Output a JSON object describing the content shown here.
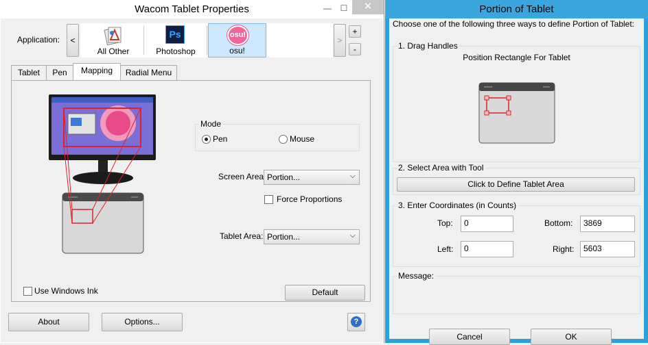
{
  "window1": {
    "title": "Wacom Tablet Properties",
    "minimize_glyph": "—",
    "maximize_glyph": "☐",
    "close_glyph": "✕",
    "application_label": "Application:",
    "scroll_left": "<",
    "scroll_right": ">",
    "add_glyph": "+",
    "remove_glyph": "-",
    "apps": [
      {
        "name": "All Other",
        "icon": "all-other-icon"
      },
      {
        "name": "Photoshop",
        "icon": "photoshop-icon",
        "icon_text": "Ps"
      },
      {
        "name": "osu!",
        "icon": "osu-icon",
        "icon_text": "osu!"
      }
    ],
    "selected_app": "osu!",
    "tabs": [
      "Tablet",
      "Pen",
      "Mapping",
      "Radial Menu"
    ],
    "active_tab": "Mapping",
    "mode": {
      "label": "Mode",
      "options": [
        "Pen",
        "Mouse"
      ],
      "selected": "Pen"
    },
    "screen_area": {
      "label": "Screen Area:",
      "value": "Portion..."
    },
    "force_proportions": {
      "label": "Force Proportions",
      "checked": false
    },
    "tablet_area": {
      "label": "Tablet Area:",
      "value": "Portion..."
    },
    "use_windows_ink": {
      "label": "Use Windows Ink",
      "checked": false
    },
    "default_button": "Default",
    "about_button": "About",
    "options_button": "Options...",
    "help_glyph": "?"
  },
  "window2": {
    "title": "Portion of Tablet",
    "instruction": "Choose one of the following three ways to define Portion of Tablet:",
    "group1": {
      "label": "1. Drag Handles",
      "caption": "Position Rectangle For Tablet"
    },
    "group2": {
      "label": "2. Select Area with Tool",
      "button": "Click to Define Tablet Area"
    },
    "group3": {
      "label": "3. Enter Coordinates (in Counts)",
      "top": {
        "label": "Top:",
        "value": "0"
      },
      "bottom": {
        "label": "Bottom:",
        "value": "3869"
      },
      "left": {
        "label": "Left:",
        "value": "0"
      },
      "right": {
        "label": "Right:",
        "value": "5603"
      }
    },
    "message_label": "Message:",
    "cancel_button": "Cancel",
    "ok_button": "OK"
  },
  "colors": {
    "accent": "#2ca0d8",
    "mapping_outline": "#e0202a",
    "osu_pink": "#f0669a",
    "photoshop_blue": "#0f1e42",
    "selected_item": "#cde8ff"
  }
}
